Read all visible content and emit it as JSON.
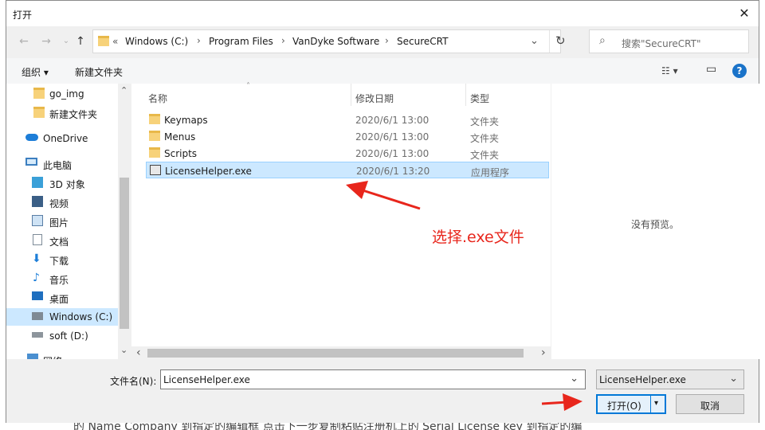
{
  "window": {
    "title": "打开",
    "close_glyph": "✕"
  },
  "nav": {
    "back": "←",
    "forward": "→",
    "up": "↑"
  },
  "address": {
    "overflow": "«",
    "crumbs": [
      "Windows  (C:)",
      "Program Files",
      "VanDyke Software",
      "SecureCRT"
    ],
    "separator": "›",
    "dropdown_glyph": "⌄",
    "refresh_glyph": "↻"
  },
  "search": {
    "placeholder": "搜索\"SecureCRT\"",
    "icon_glyph": "⌕"
  },
  "toolbar": {
    "organize": "组织 ▾",
    "new_folder": "新建文件夹",
    "view_glyph": "☷ ▾",
    "pane_glyph": "▭",
    "help_glyph": "?"
  },
  "sidebar": {
    "items": [
      {
        "label": "go_img",
        "icon": "folder-icon"
      },
      {
        "label": "新建文件夹",
        "icon": "folder-icon"
      },
      {
        "label": "OneDrive",
        "icon": "cloud-icon"
      },
      {
        "label": "此电脑",
        "icon": "computer-icon"
      },
      {
        "label": "3D 对象",
        "icon": "cube-icon"
      },
      {
        "label": "视频",
        "icon": "video-icon"
      },
      {
        "label": "图片",
        "icon": "picture-icon"
      },
      {
        "label": "文档",
        "icon": "document-icon"
      },
      {
        "label": "下载",
        "icon": "download-icon"
      },
      {
        "label": "音乐",
        "icon": "music-icon"
      },
      {
        "label": "桌面",
        "icon": "desktop-icon"
      },
      {
        "label": "Windows  (C:)",
        "icon": "drive-icon"
      },
      {
        "label": "soft (D:)",
        "icon": "drive-icon"
      },
      {
        "label": "网络",
        "icon": "network-icon"
      }
    ],
    "scroll_up": "⌃",
    "scroll_down": "⌄"
  },
  "files": {
    "columns": [
      "名称",
      "修改日期",
      "类型"
    ],
    "sort_glyph": "˄",
    "rows": [
      {
        "name": "Keymaps",
        "date": "2020/6/1 13:00",
        "type": "文件夹"
      },
      {
        "name": "Menus",
        "date": "2020/6/1 13:00",
        "type": "文件夹"
      },
      {
        "name": "Scripts",
        "date": "2020/6/1 13:00",
        "type": "文件夹"
      },
      {
        "name": "LicenseHelper.exe",
        "date": "2020/6/1 13:20",
        "type": "应用程序"
      }
    ],
    "scroll_left": "‹",
    "scroll_right": "›"
  },
  "preview": {
    "text": "没有预览。"
  },
  "annotation": {
    "text": "选择.exe文件",
    "color": "#e8261c"
  },
  "bottom": {
    "filename_label": "文件名(N):",
    "filename_value": "LicenseHelper.exe",
    "filter_value": "LicenseHelper.exe",
    "open_label": "打开(O)",
    "cancel_label": "取消",
    "dropdown_glyph": "⌄",
    "split_glyph": "▾"
  },
  "background_text": "的 Name    Company 到指定的编辑框    点击下一步复制粘贴注册机上的 Serial    License key 到指定的编"
}
